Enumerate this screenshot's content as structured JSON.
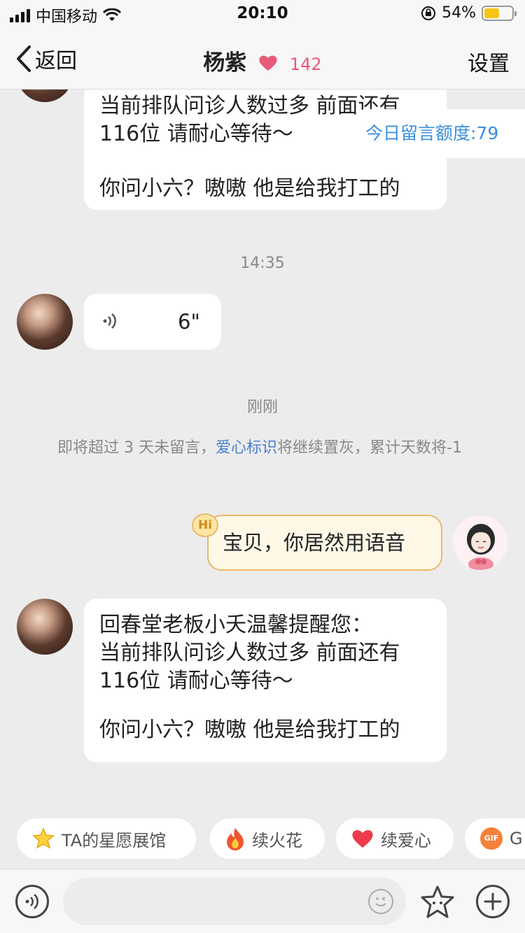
{
  "status_bar": {
    "carrier": "中国移动",
    "time": "20:10",
    "battery": "54%",
    "battery_level": 0.54
  },
  "nav": {
    "back_label": "返回",
    "title": "杨紫",
    "heart_count": "142",
    "settings_label": "设置"
  },
  "quota": {
    "label": "今日留言额度:79"
  },
  "messages": {
    "m1": {
      "line1": "当前排队问诊人数过多 前面还有",
      "line2": "116位 请耐心等待～",
      "line3": "你问小六？嗷嗷 他是给我打工的"
    },
    "time1": "14:35",
    "voice_duration": "6\"",
    "time2": "刚刚",
    "notice": {
      "part1": "即将超过 3 天未留言，",
      "link": "爱心标识",
      "part2": "将继续置灰，累计天数将-1"
    },
    "my_badge": "Hi",
    "my_text": "宝贝，你居然用语音",
    "m2": {
      "line1": "回春堂老板小夭温馨提醒您：",
      "line2": "当前排队问诊人数过多 前面还有",
      "line3": "116位 请耐心等待～",
      "line4": "你问小六？嗷嗷 他是给我打工的"
    }
  },
  "chips": [
    {
      "label": "TA的星愿展馆",
      "icon": "star-icon"
    },
    {
      "label": "续火花",
      "icon": "fire-icon"
    },
    {
      "label": "续爱心",
      "icon": "heart-icon"
    },
    {
      "label": "G",
      "icon": "gif-icon",
      "icon_text": "GIF"
    }
  ],
  "colors": {
    "accent_blue": "#3a8fe0",
    "heart_pink": "#e85a7a",
    "my_bubble_border": "#e8b86a"
  }
}
